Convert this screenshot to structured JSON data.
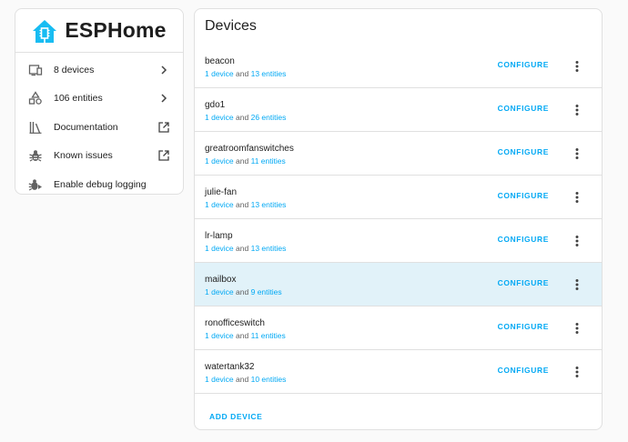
{
  "brand": {
    "name": "ESPHome",
    "logo_icon": "esphome-house-icon",
    "accent": "#18bcf2"
  },
  "sidebar": {
    "items": [
      {
        "label": "8 devices",
        "icon": "devices-icon",
        "trail": "chevron-right-icon"
      },
      {
        "label": "106 entities",
        "icon": "shapes-icon",
        "trail": "chevron-right-icon"
      },
      {
        "label": "Documentation",
        "icon": "library-books-icon",
        "trail": "open-in-new-icon"
      },
      {
        "label": "Known issues",
        "icon": "bug-icon",
        "trail": "open-in-new-icon"
      },
      {
        "label": "Enable debug logging",
        "icon": "bug-play-icon",
        "trail": ""
      }
    ]
  },
  "devices": {
    "title": "Devices",
    "configure_label": "CONFIGURE",
    "add_label": "ADD DEVICE",
    "link_color": "#03a9f4",
    "highlight_color": "#e1f2f9",
    "rows": [
      {
        "name": "beacon",
        "devices": "1 device",
        "and": "and",
        "entities": "13 entities",
        "highlight": false
      },
      {
        "name": "gdo1",
        "devices": "1 device",
        "and": "and",
        "entities": "26 entities",
        "highlight": false
      },
      {
        "name": "greatroomfanswitches",
        "devices": "1 device",
        "and": "and",
        "entities": "11 entities",
        "highlight": false
      },
      {
        "name": "julie-fan",
        "devices": "1 device",
        "and": "and",
        "entities": "13 entities",
        "highlight": false
      },
      {
        "name": "lr-lamp",
        "devices": "1 device",
        "and": "and",
        "entities": "13 entities",
        "highlight": false
      },
      {
        "name": "mailbox",
        "devices": "1 device",
        "and": "and",
        "entities": "9 entities",
        "highlight": true
      },
      {
        "name": "ronofficeswitch",
        "devices": "1 device",
        "and": "and",
        "entities": "11 entities",
        "highlight": false
      },
      {
        "name": "watertank32",
        "devices": "1 device",
        "and": "and",
        "entities": "10 entities",
        "highlight": false
      }
    ]
  }
}
